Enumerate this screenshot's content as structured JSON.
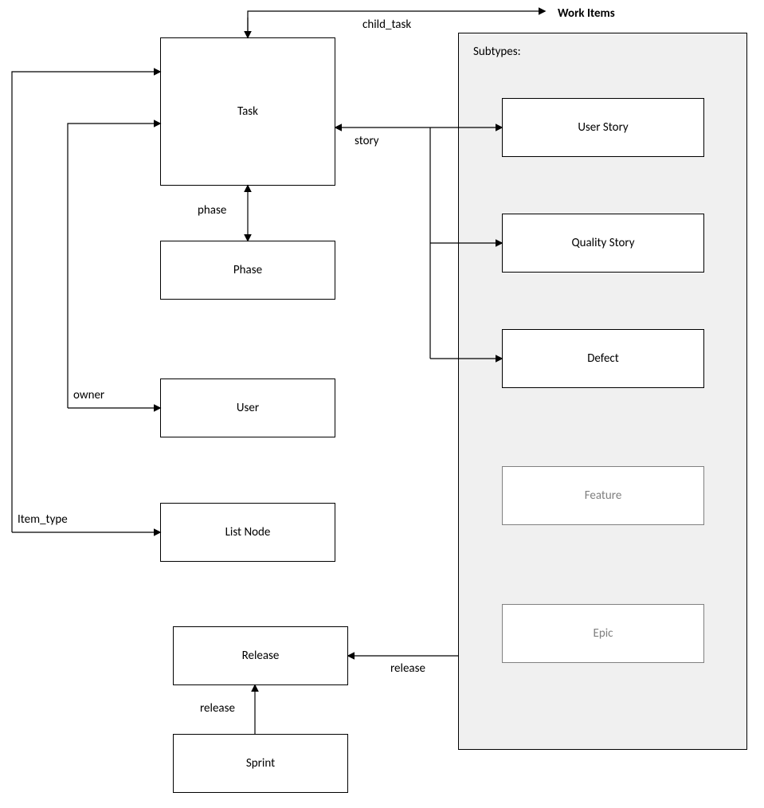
{
  "title": "Work Items",
  "panel": {
    "title": "Subtypes:"
  },
  "boxes": {
    "task": "Task",
    "phase": "Phase",
    "user": "User",
    "list_node": "List Node",
    "release": "Release",
    "sprint": "Sprint"
  },
  "subtypes": {
    "user_story": "User Story",
    "quality_story": "Quality Story",
    "defect": "Defect",
    "feature": "Feature",
    "epic": "Epic"
  },
  "edges": {
    "child_task": "child_task",
    "story": "story",
    "phase": "phase",
    "owner": "owner",
    "item_type": "Item_type",
    "release_to_release": "release",
    "sprint_release": "release"
  }
}
